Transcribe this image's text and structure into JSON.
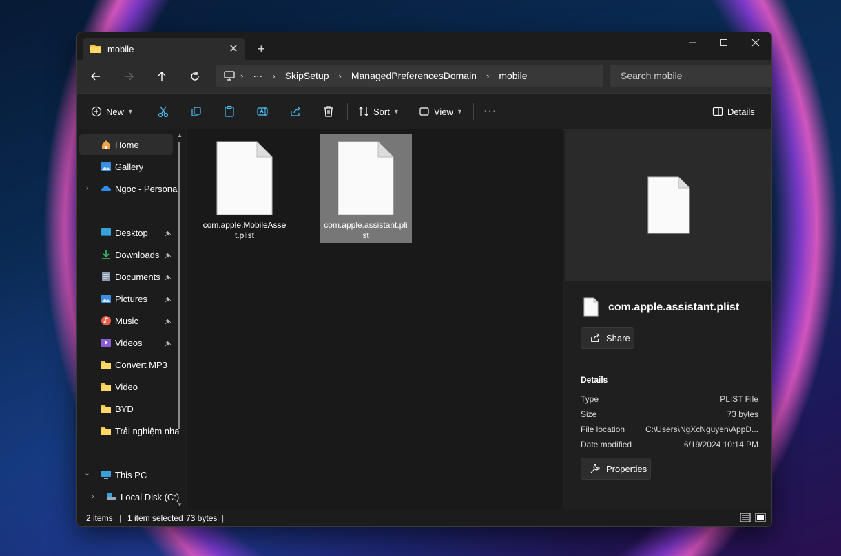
{
  "window": {
    "tab_title": "mobile",
    "tab_close_glyph": "✕",
    "new_tab_glyph": "+"
  },
  "address": {
    "overflow": "···",
    "segments": [
      "SkipSetup",
      "ManagedPreferencesDomain",
      "mobile"
    ]
  },
  "search": {
    "placeholder": "Search mobile"
  },
  "toolbar": {
    "new_label": "New",
    "sort_label": "Sort",
    "view_label": "View",
    "details_label": "Details",
    "more_glyph": "···"
  },
  "sidebar": {
    "home": "Home",
    "gallery": "Gallery",
    "onedrive": "Ngọc - Personal",
    "quick": [
      "Desktop",
      "Downloads",
      "Documents",
      "Pictures",
      "Music",
      "Videos"
    ],
    "folders": [
      "Convert MP3",
      "Video",
      "BYD",
      "Trải nghiệm nha"
    ],
    "this_pc": "This PC",
    "local_disk": "Local Disk (C:)"
  },
  "files": [
    {
      "name": "com.apple.MobileAsset.plist",
      "selected": false
    },
    {
      "name": "com.apple.assistant.plist",
      "selected": true
    }
  ],
  "details_pane": {
    "file_name": "com.apple.assistant.plist",
    "share_label": "Share",
    "section_title": "Details",
    "rows": [
      {
        "key": "Type",
        "value": "PLIST File"
      },
      {
        "key": "Size",
        "value": "73 bytes"
      },
      {
        "key": "File location",
        "value": "C:\\Users\\NgXcNguyen\\AppD..."
      },
      {
        "key": "Date modified",
        "value": "6/19/2024 10:14 PM"
      }
    ],
    "properties_label": "Properties"
  },
  "status": {
    "items": "2 items",
    "selected": "1 item selected",
    "size": "73 bytes",
    "sep": "|"
  },
  "colors": {
    "accent": "#4cc2ff",
    "folder": "#f4c542",
    "selected": "#777777"
  }
}
